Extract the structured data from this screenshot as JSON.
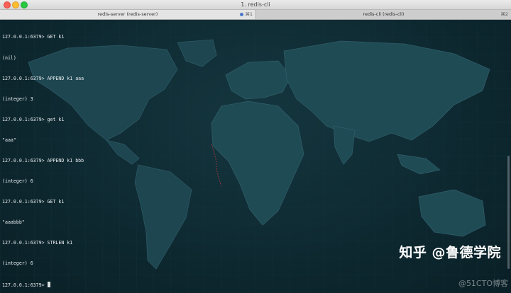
{
  "window": {
    "title": "1. redis-cli"
  },
  "tabs": [
    {
      "label": "redis-server (redis-server)",
      "shortcut": "⌘1",
      "active": true
    },
    {
      "label": "redis-cli (redis-cli)",
      "shortcut": "⌘2",
      "active": false
    }
  ],
  "terminal": {
    "lines": [
      "127.0.0.1:6379> GET k1",
      "(nil)",
      "127.0.0.1:6379> APPEND k1 aaa",
      "(integer) 3",
      "127.0.0.1:6379> get k1",
      "\"aaa\"",
      "127.0.0.1:6379> APPEND k1 bbb",
      "(integer) 6",
      "127.0.0.1:6379> GET k1",
      "\"aaabbb\"",
      "127.0.0.1:6379> STRLEN k1",
      "(integer) 6"
    ],
    "prompt": "127.0.0.1:6379> "
  },
  "watermark": {
    "text": "知乎 @鲁德学院",
    "sub": "@51CTO博客"
  },
  "colors": {
    "background": "#0d2730",
    "text": "#e6ecee",
    "close": "#fc5f57",
    "minimize": "#fdbc2e",
    "maximize": "#28c840"
  }
}
